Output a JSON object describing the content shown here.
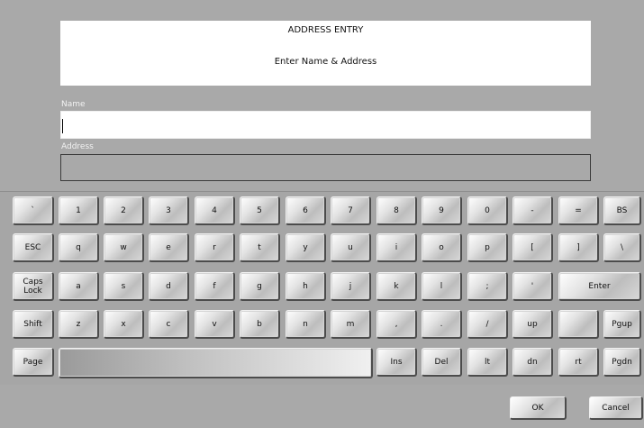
{
  "header": {
    "title": "ADDRESS ENTRY",
    "subtitle": "Enter Name & Address"
  },
  "fields": {
    "name_label": "Name",
    "name_value": "",
    "address_label": "Address",
    "address_value": ""
  },
  "keyboard": {
    "row1": [
      "`",
      "1",
      "2",
      "3",
      "4",
      "5",
      "6",
      "7",
      "8",
      "9",
      "0",
      "-",
      "=",
      "BS"
    ],
    "row2": [
      "ESC",
      "q",
      "w",
      "e",
      "r",
      "t",
      "y",
      "u",
      "i",
      "o",
      "p",
      "[",
      "]",
      "\\"
    ],
    "row3": [
      "Caps\nLock",
      "a",
      "s",
      "d",
      "f",
      "g",
      "h",
      "j",
      "k",
      "l",
      ";",
      "'",
      "Enter"
    ],
    "row4": [
      "Shift",
      "z",
      "x",
      "c",
      "v",
      "b",
      "n",
      "m",
      ",",
      ".",
      "/",
      "up",
      "",
      "Pgup"
    ],
    "row5": [
      "Page",
      "",
      "Ins",
      "Del",
      "lt",
      "dn",
      "rt",
      "Pgdn"
    ]
  },
  "actions": {
    "ok": "OK",
    "cancel": "Cancel"
  }
}
